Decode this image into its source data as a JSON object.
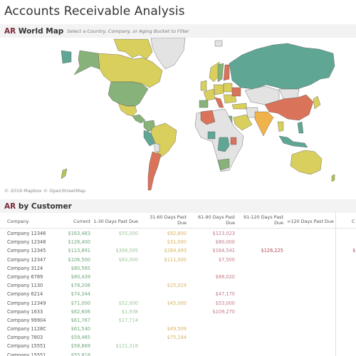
{
  "page": {
    "title": "Accounts Receivable Analysis"
  },
  "map_section": {
    "title_accent": "AR",
    "title_rest": " World Map",
    "hint": "Select a Country, Company, or Aging Bucket to Filter",
    "credit": "© 2019 Mapbox © OpenStreetMap",
    "colors": {
      "teal": "#5fa694",
      "green": "#87b27a",
      "yellow": "#d9cf5c",
      "orange": "#f0b24a",
      "red": "#d9735a",
      "grey": "#e3e3e3"
    }
  },
  "customer_section": {
    "title_accent": "AR",
    "title_rest": " by Customer",
    "columns": [
      "Company",
      "Current",
      "1-30 Days Past Due",
      "31-60 Days Past Due",
      "61-90 Days Past Due",
      "91-120 Days Past Due",
      ">120 Days Past Due"
    ],
    "column_lines": {
      "d60": [
        "31-60 Days Past",
        "Due"
      ],
      "d90": [
        "61-90 Days Past",
        "Due"
      ],
      "d120": [
        "91-120 Days Past",
        "Due"
      ]
    },
    "overflow_header": "C",
    "rows": [
      {
        "company": "Company 12346",
        "current": "$163,483",
        "d30": "$55,000",
        "d60": "$92,800",
        "d90": "$123,023",
        "d120": "",
        "over": "",
        "overflow": ""
      },
      {
        "company": "Company 12348",
        "current": "$126,400",
        "d30": "",
        "d60": "$31,000",
        "d90": "$80,000",
        "d120": "",
        "over": "",
        "overflow": ""
      },
      {
        "company": "Company 12345",
        "current": "$113,891",
        "d30": "$398,095",
        "d60": "$284,493",
        "d90": "$164,541",
        "d120": "$126,225",
        "over": "",
        "overflow": "$"
      },
      {
        "company": "Company 12347",
        "current": "$106,500",
        "d30": "$83,000",
        "d60": "$111,000",
        "d90": "$7,500",
        "d120": "",
        "over": "",
        "overflow": ""
      },
      {
        "company": "Company 3124",
        "current": "$80,565",
        "d30": "",
        "d60": "",
        "d90": "",
        "d120": "",
        "over": "",
        "overflow": ""
      },
      {
        "company": "Company 6789",
        "current": "$80,439",
        "d30": "",
        "d60": "",
        "d90": "$88,020",
        "d120": "",
        "over": "",
        "overflow": ""
      },
      {
        "company": "Company 1130",
        "current": "$78,208",
        "d30": "",
        "d60": "$25,019",
        "d90": "",
        "d120": "",
        "over": "",
        "overflow": ""
      },
      {
        "company": "Company 6214",
        "current": "$74,344",
        "d30": "",
        "d60": "",
        "d90": "$47,170",
        "d120": "",
        "over": "",
        "overflow": ""
      },
      {
        "company": "Company 12349",
        "current": "$71,000",
        "d30": "$52,000",
        "d60": "$45,000",
        "d90": "$53,000",
        "d120": "",
        "over": "",
        "overflow": ""
      },
      {
        "company": "Company 1633",
        "current": "$62,606",
        "d30": "$1,938",
        "d60": "",
        "d90": "$109,270",
        "d120": "",
        "over": "",
        "overflow": ""
      },
      {
        "company": "Company 99904",
        "current": "$61,767",
        "d30": "$17,714",
        "d60": "",
        "d90": "",
        "d120": "",
        "over": "",
        "overflow": ""
      },
      {
        "company": "Company 1128C",
        "current": "$61,540",
        "d30": "",
        "d60": "$49,509",
        "d90": "",
        "d120": "",
        "over": "",
        "overflow": ""
      },
      {
        "company": "Company 7803",
        "current": "$59,465",
        "d30": "",
        "d60": "$75,164",
        "d90": "",
        "d120": "",
        "over": "",
        "overflow": ""
      },
      {
        "company": "Company 15551",
        "current": "$58,869",
        "d30": "$121,318",
        "d60": "",
        "d90": "",
        "d120": "",
        "over": "",
        "overflow": ""
      },
      {
        "company": "Company 15551",
        "current": "$55,818",
        "d30": "",
        "d60": "",
        "d90": "",
        "d120": "",
        "over": "",
        "overflow": ""
      }
    ]
  }
}
